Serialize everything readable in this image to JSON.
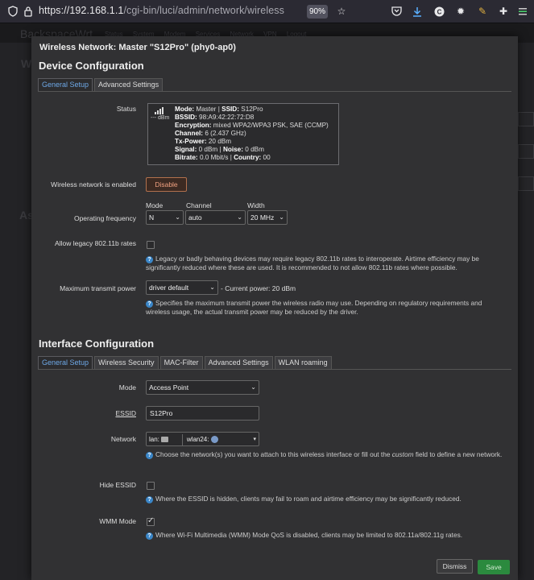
{
  "browser": {
    "url_host": "https://192.168.1.1",
    "url_path": "/cgi-bin/luci/admin/network/wireless",
    "zoom": "90%"
  },
  "background": {
    "brand": "BackspaceWrt",
    "nav": "Status System Modem Services Network VPN Logout"
  },
  "modal": {
    "title": "Wireless Network: Master \"S12Pro\" (phy0-ap0)",
    "device_section": "Device Configuration",
    "device_tabs": [
      "General Setup",
      "Advanced Settings"
    ],
    "status_label": "Status",
    "signal_dbm": "--- dBm",
    "status_lines": {
      "mode_key": "Mode:",
      "mode_val": "Master",
      "ssid_key": "SSID:",
      "ssid_val": "S12Pro",
      "bssid_key": "BSSID:",
      "bssid_val": "98:A9:42:22:72:D8",
      "enc_key": "Encryption:",
      "enc_val": "mixed WPA2/WPA3 PSK, SAE (CCMP)",
      "chan_key": "Channel:",
      "chan_val": "6 (2.437 GHz)",
      "tx_key": "Tx-Power:",
      "tx_val": "20 dBm",
      "sig_key": "Signal:",
      "sig_val": "0 dBm",
      "noise_key": "Noise:",
      "noise_val": "0 dBm",
      "bitrate_key": "Bitrate:",
      "bitrate_val": "0.0 Mbit/s",
      "country_key": "Country:",
      "country_val": "00"
    },
    "enabled_label": "Wireless network is enabled",
    "disable_button": "Disable",
    "freq_label": "Operating frequency",
    "freq": {
      "mode_label": "Mode",
      "mode_val": "N",
      "channel_label": "Channel",
      "channel_val": "auto",
      "width_label": "Width",
      "width_val": "20 MHz"
    },
    "legacy_label": "Allow legacy 802.11b rates",
    "legacy_help": "Legacy or badly behaving devices may require legacy 802.11b rates to interoperate. Airtime efficiency may be significantly reduced where these are used. It is recommended to not allow 802.11b rates where possible.",
    "txpower_label": "Maximum transmit power",
    "txpower_val": "driver default",
    "txpower_current": "- Current power: 20 dBm",
    "txpower_help": "Specifies the maximum transmit power the wireless radio may use. Depending on regulatory requirements and wireless usage, the actual transmit power may be reduced by the driver.",
    "iface_section": "Interface Configuration",
    "iface_tabs": [
      "General Setup",
      "Wireless Security",
      "MAC-Filter",
      "Advanced Settings",
      "WLAN roaming"
    ],
    "mode_label": "Mode",
    "mode_val": "Access Point",
    "essid_label": "ESSID",
    "essid_val": "S12Pro",
    "network_label": "Network",
    "network_chip1": "lan:",
    "network_chip2": "wlan24:",
    "network_help_a": "Choose the network(s) you want to attach to this wireless interface or fill out the ",
    "network_help_custom": "custom",
    "network_help_b": " field to define a new network.",
    "hide_label": "Hide ESSID",
    "hide_help": "Where the ESSID is hidden, clients may fail to roam and airtime efficiency may be significantly reduced.",
    "wmm_label": "WMM Mode",
    "wmm_help": "Where Wi-Fi Multimedia (WMM) Mode QoS is disabled, clients may be limited to 802.11a/802.11g rates.",
    "dismiss_button": "Dismiss",
    "save_button": "Save"
  }
}
